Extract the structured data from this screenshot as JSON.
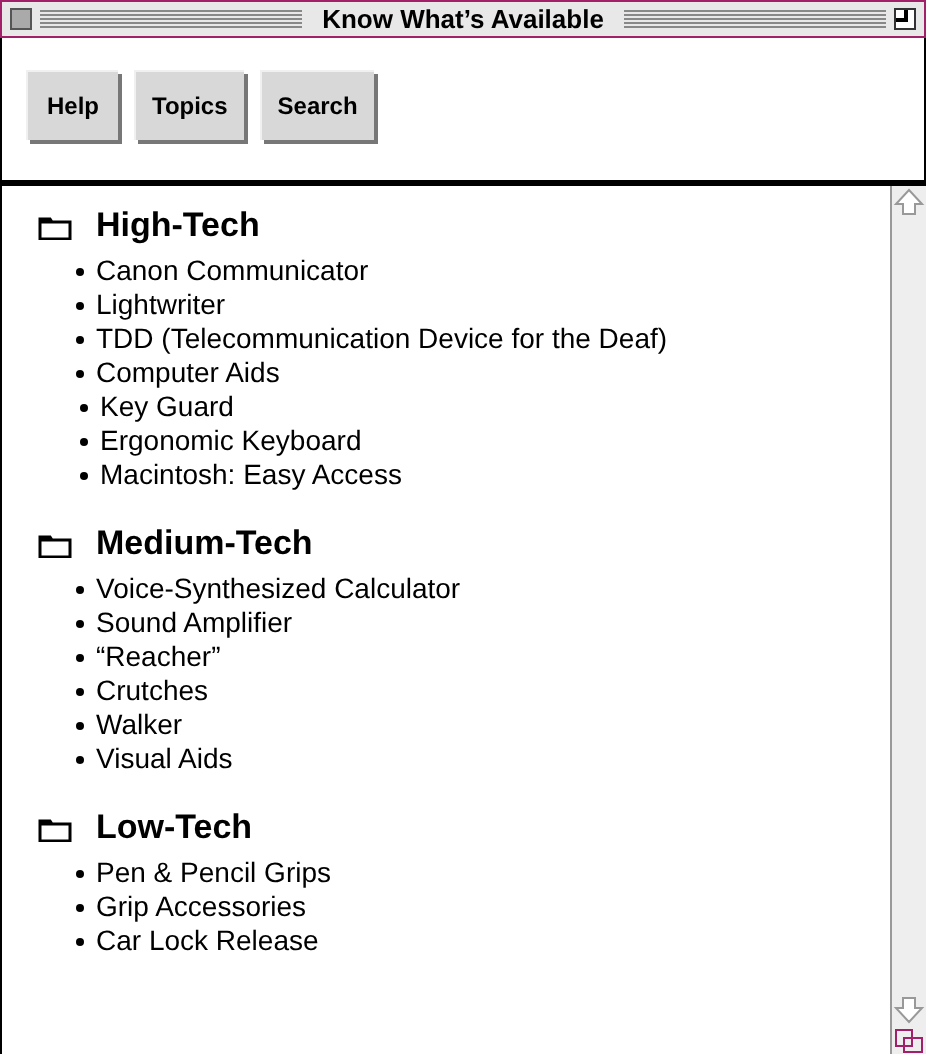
{
  "window": {
    "title": "Know What’s Available"
  },
  "toolbar": {
    "buttons": [
      "Help",
      "Topics",
      "Search"
    ]
  },
  "sections": [
    {
      "title": "High-Tech",
      "items": [
        {
          "label": "Canon Communicator"
        },
        {
          "label": "Lightwriter"
        },
        {
          "label": "TDD (Telecommunication Device for the Deaf)"
        },
        {
          "label": "Computer Aids",
          "children": [
            {
              "label": "Key Guard"
            },
            {
              "label": "Ergonomic Keyboard"
            },
            {
              "label": "Macintosh: Easy Access"
            }
          ]
        }
      ]
    },
    {
      "title": "Medium-Tech",
      "items": [
        {
          "label": "Voice-Synthesized Calculator"
        },
        {
          "label": "Sound Amplifier"
        },
        {
          "label": "“Reacher”"
        },
        {
          "label": "Crutches"
        },
        {
          "label": "Walker"
        },
        {
          "label": "Visual Aids"
        }
      ]
    },
    {
      "title": "Low-Tech",
      "items": [
        {
          "label": "Pen & Pencil Grips"
        },
        {
          "label": "Grip Accessories"
        },
        {
          "label": "Car Lock Release"
        }
      ]
    }
  ]
}
